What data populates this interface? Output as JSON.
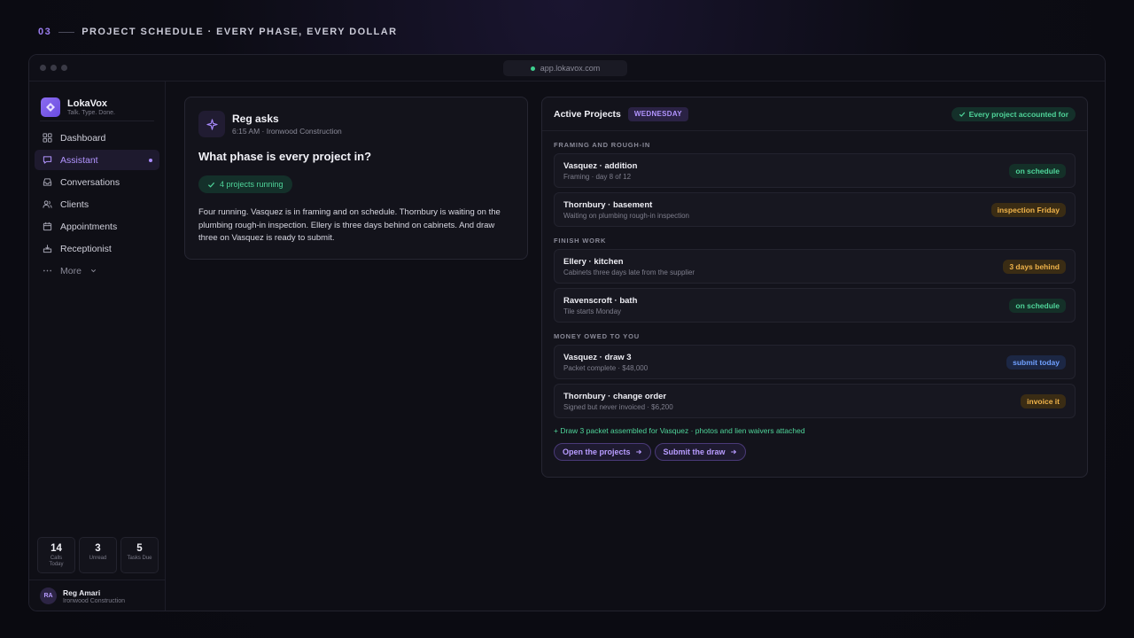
{
  "slide": {
    "number": "03",
    "title": "PROJECT SCHEDULE · EVERY PHASE, EVERY DOLLAR"
  },
  "window": {
    "url": "app.lokavox.com"
  },
  "brand": {
    "name": "LokaVox",
    "tagline": "Talk. Type. Done."
  },
  "nav": {
    "items": [
      {
        "label": "Dashboard",
        "icon": "grid-icon"
      },
      {
        "label": "Assistant",
        "icon": "chat-icon",
        "active": true
      },
      {
        "label": "Conversations",
        "icon": "inbox-icon"
      },
      {
        "label": "Clients",
        "icon": "users-icon"
      },
      {
        "label": "Appointments",
        "icon": "calendar-icon"
      },
      {
        "label": "Receptionist",
        "icon": "phone-icon"
      }
    ],
    "more": "More"
  },
  "stats": [
    {
      "value": "14",
      "label": "Calls Today"
    },
    {
      "value": "3",
      "label": "Unread"
    },
    {
      "value": "5",
      "label": "Tasks Due"
    }
  ],
  "user": {
    "initials": "RA",
    "name": "Reg Amari",
    "company": "Ironwood Construction"
  },
  "ask": {
    "title": "Reg asks",
    "meta": "6:15 AM · Ironwood Construction",
    "question": "What phase is every project in?",
    "chip": "4 projects running",
    "body": "Four running. Vasquez is in framing and on schedule. Thornbury is waiting on the plumbing rough-in inspection. Ellery is three days behind on cabinets. And draw three on Vasquez is ready to submit."
  },
  "projects": {
    "title": "Active Projects",
    "day": "WEDNESDAY",
    "status": "Every project accounted for",
    "sections": [
      {
        "label": "FRAMING AND ROUGH-IN",
        "rows": [
          {
            "title": "Vasquez · addition",
            "sub": "Framing · day 8 of 12",
            "pill": "on schedule",
            "tone": "green"
          },
          {
            "title": "Thornbury · basement",
            "sub": "Waiting on plumbing rough-in inspection",
            "pill": "inspection Friday",
            "tone": "amber"
          }
        ]
      },
      {
        "label": "FINISH WORK",
        "rows": [
          {
            "title": "Ellery · kitchen",
            "sub": "Cabinets three days late from the supplier",
            "pill": "3 days behind",
            "tone": "amber"
          },
          {
            "title": "Ravenscroft · bath",
            "sub": "Tile starts Monday",
            "pill": "on schedule",
            "tone": "green"
          }
        ]
      },
      {
        "label": "MONEY OWED TO YOU",
        "rows": [
          {
            "title": "Vasquez · draw 3",
            "sub": "Packet complete · $48,000",
            "pill": "submit today",
            "tone": "blue"
          },
          {
            "title": "Thornbury · change order",
            "sub": "Signed but never invoiced · $6,200",
            "pill": "invoice it",
            "tone": "amber"
          }
        ]
      }
    ],
    "note": "+ Draw 3 packet assembled for Vasquez · photos and lien waivers attached",
    "actions": [
      "Open the projects",
      "Submit the draw"
    ]
  },
  "colors": {
    "accent": "#9b7ef0",
    "green": "#4fd59a",
    "amber": "#f0b34a",
    "blue": "#6fa0ff"
  }
}
